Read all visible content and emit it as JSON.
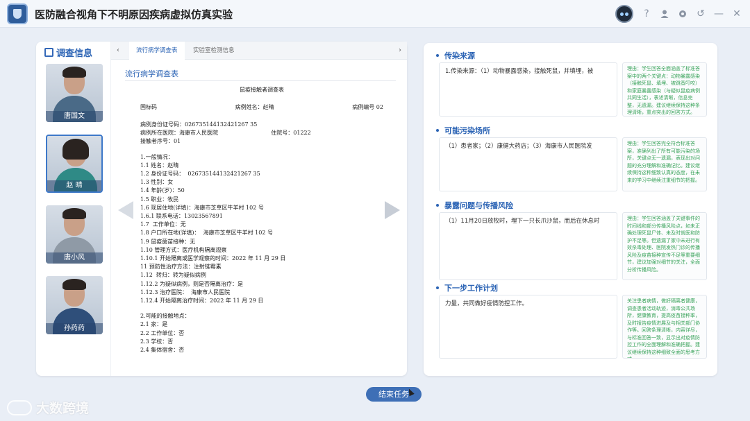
{
  "app": {
    "title": "医防融合视角下不明原因疾病虚拟仿真实验"
  },
  "titlebar": {
    "icons": [
      "robot-avatar-icon",
      "help-icon",
      "user-icon",
      "settings-icon",
      "back-icon",
      "minimize-icon",
      "close-icon"
    ],
    "help_glyph": "?",
    "back_glyph": "↺",
    "min_glyph": "—",
    "close_glyph": "✕"
  },
  "sidebar": {
    "title": "调查信息",
    "people": [
      {
        "name": "唐国文"
      },
      {
        "name": "赵 晴"
      },
      {
        "name": "唐小风"
      },
      {
        "name": "孙药药"
      }
    ]
  },
  "tabs": {
    "prev": "‹",
    "next": "›",
    "items": [
      {
        "label": "流行病学调查表"
      },
      {
        "label": "实验室检测信息"
      }
    ]
  },
  "document": {
    "title": "流行病学调查表",
    "heading": "鼠疫接触者调查表",
    "row1": {
      "a": "国标码",
      "b": "病例姓名：赵晴",
      "c": "病例编号 02"
    },
    "lines1": [
      "病例身份证号码：026735144132421267 35",
      "病例所在医院：海康市人民医院                              住院号：01222",
      "接触者序号：01"
    ],
    "lines2": [
      "1.一般情况：",
      "1.1 姓名：赵晴",
      "1.2 身份证号码：  026735144132421267 35",
      "1.3 性别：女",
      "1.4 年龄(岁)：50",
      "1.5 职业：牧民",
      "1.6 现居住地(详填)：海康市芝草区牛羊村 102 号",
      "1.6.1 联系电话：13023567891",
      "1.7  工作单位：无",
      "1.8 户口所在地(详填)：  海康市芝草区牛羊村 102 号",
      "1.9 鼠疫菌苗接种：无",
      "1.10 管理方式：医疗机构隔离观察",
      "1.10.1 开始隔离或医学观察的时间：2022 年 11 月 29 日",
      "11 预防性治疗方法：注射链霉素",
      "1.12  转归：转为疑似病例",
      "1.12.2 为疑似病例，则是否隔离治疗：是",
      "1.12.3 治疗医院：  海康市人民医院",
      "1.12.4 开始隔离治疗时间：2022 年 11 月 29 日"
    ],
    "lines3": [
      "2.可能的接触地点：",
      "2.1 家：是",
      "2.2 工作单位：否",
      "2.3 学校：否",
      "2.4 集体宿舍：否"
    ]
  },
  "sections": [
    {
      "title": "传染来源",
      "body": "1.传染来源：（1）动物暴露感染，接触死鼠，并填埋，被",
      "note": "理由：学生回答全面涵盖了标准答案中的两个关键点：动物暴露感染（接触死鼠、填埋、被跳蚤叮咬）和家庭暴露感染（与疑似鼠疫病例共同生活），表述清晰，信息完整，无遗漏。建议继续保持这种条理清晰，重点突出的回答方式。"
    },
    {
      "title": "可能污染场所",
      "body": "（1）患者家；（2）康健大药店；（3）海康市人民医院发",
      "note": "理由：学生回答完全符合标准答案，准确列出了所有可能污染的场所，关键点无一遗漏，表现出对问题的充分理解和准确记忆。建议继续保持这种细致认真的态度，在未来的学习中继续注重细节的把握。"
    },
    {
      "title": "暴露问题与传播风险",
      "body": "（1）11月20日放牧时，埋下一只长爪沙鼠，而后在休息时",
      "note": "理由：学生回答涵盖了关键事件的时间线和部分传播风险点，如未正确处理死鼠尸体、未及时就医和防护不足等。但遗漏了家中未进行有效杀毒处理、医院发热门诊的传播风险及疫苗接种宣传不足等重要细节，建议加强对细节的关注，全面分析传播风险。"
    },
    {
      "title": "下一步工作计划",
      "body": "力量，共同做好疫情防控工作。",
      "note": "关注患者病情，做好隔离者健康，调查患者活动轨迹，消毒公共场所，健康教育，提高疫苗接种率，及时报告疫情进展及与相关部门协作等。回答条理清晰，内容详尽，与标准回答一致，显示出对疫情防控工作的全面理解和准确把握。建议继续保持这种细致全面的思考方式。"
    }
  ],
  "footer": {
    "end_button": "结束任务",
    "watermark": "大数跨境"
  }
}
